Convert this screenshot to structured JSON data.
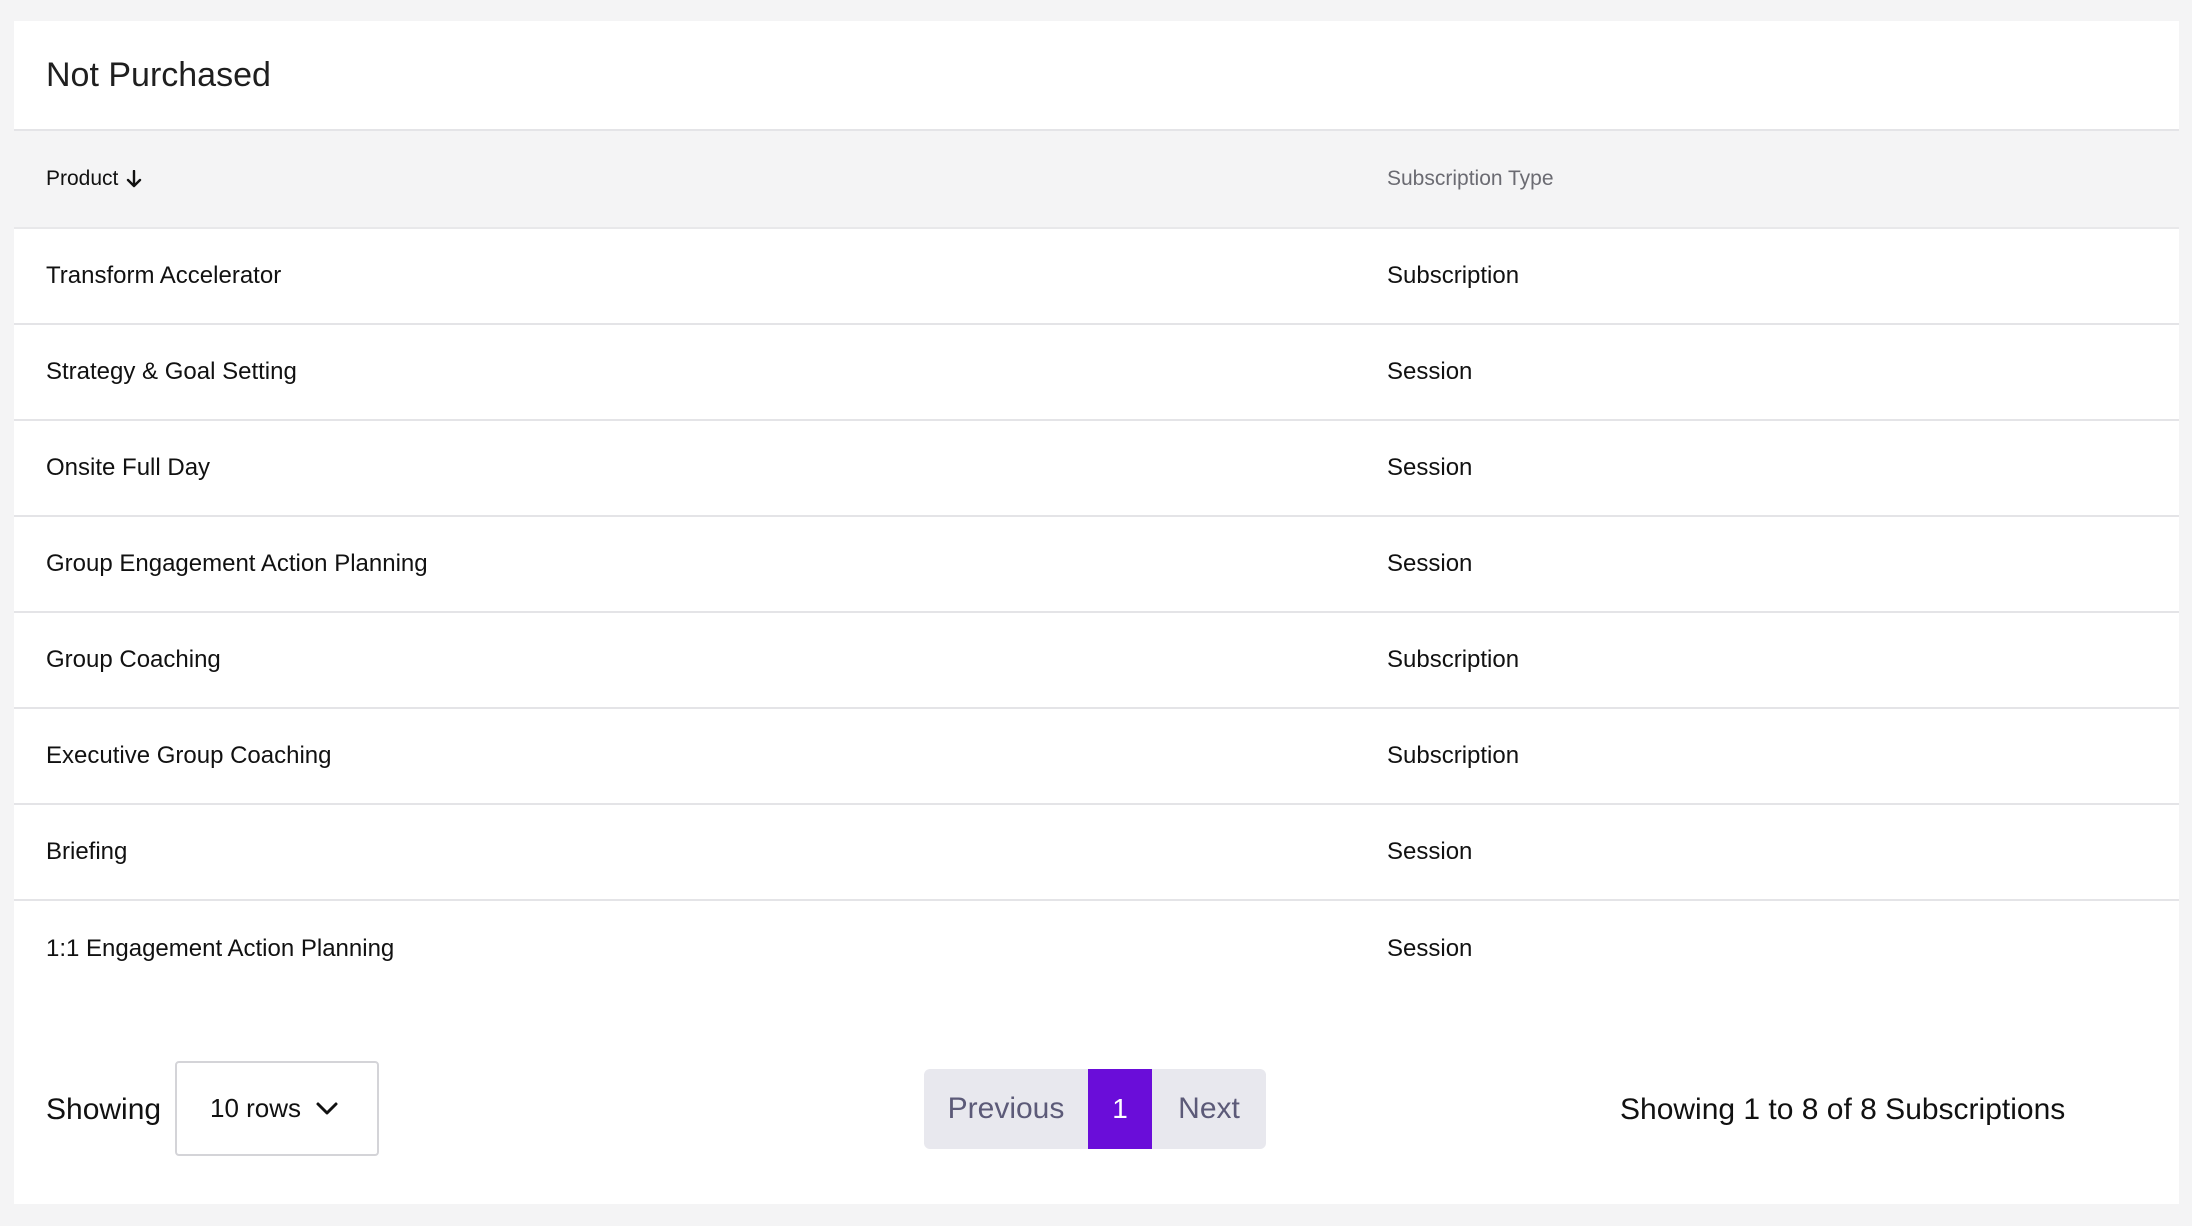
{
  "card": {
    "title": "Not Purchased"
  },
  "table": {
    "headers": {
      "product": "Product",
      "subscription_type": "Subscription Type"
    },
    "sort": {
      "column": "Product",
      "direction": "descending",
      "icon": "arrow-down-icon"
    },
    "rows": [
      {
        "product": "Transform Accelerator",
        "type": "Subscription"
      },
      {
        "product": "Strategy & Goal Setting",
        "type": "Session"
      },
      {
        "product": "Onsite Full Day",
        "type": "Session"
      },
      {
        "product": "Group Engagement Action Planning",
        "type": "Session"
      },
      {
        "product": "Group Coaching",
        "type": "Subscription"
      },
      {
        "product": "Executive Group Coaching",
        "type": "Subscription"
      },
      {
        "product": "Briefing",
        "type": "Session"
      },
      {
        "product": "1:1 Engagement Action Planning",
        "type": "Session"
      }
    ]
  },
  "footer": {
    "showing_label": "Showing",
    "rows_select": {
      "value": "10 rows",
      "icon": "chevron-down-icon"
    },
    "pagination": {
      "previous_label": "Previous",
      "current_page": "1",
      "next_label": "Next"
    },
    "summary": "Showing 1 to 8 of 8 Subscriptions"
  },
  "colors": {
    "accent": "#6a0dd9",
    "header_bg": "#f4f4f5",
    "pager_bg": "#e8e8ee"
  }
}
